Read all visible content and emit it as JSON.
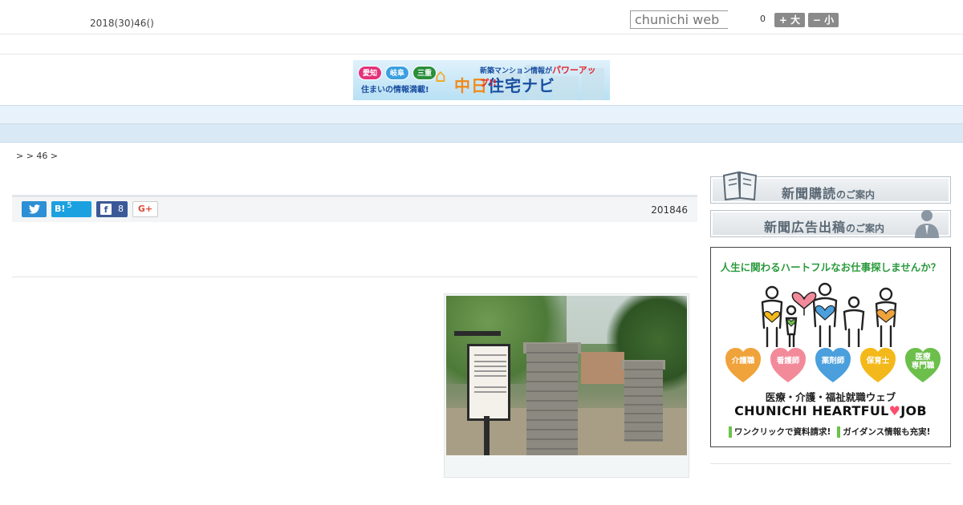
{
  "header": {
    "date": "2018(30)46()",
    "search_placeholder": "chunichi web",
    "font_size_value": "0",
    "font_larger_label": "+ 大",
    "font_smaller_label": "− 小"
  },
  "banner": {
    "pill_aichi": "愛知",
    "pill_gifu": "岐阜",
    "pill_mie": "三重",
    "tagline": "住まいの情報満載!",
    "headline": "新築マンション情報が",
    "headline_up": "パワーアップ!!",
    "brand_a": "中日",
    "brand_b": "住宅ナビ"
  },
  "nav": {
    "items": [
      "",
      "",
      "",
      "",
      "",
      "",
      "",
      "",
      ""
    ]
  },
  "breadcrumb": ">  > 46 >",
  "share": {
    "twitter_icon": "twitter-bird-icon",
    "hatena_label": "B!",
    "hatena_count": "5",
    "facebook_label": "f",
    "facebook_count": "8",
    "googleplus_label": "G+",
    "post_date": "201846"
  },
  "sidebar": {
    "subscribe_main": "新聞購読",
    "subscribe_small": "のご案内",
    "ad_main": "新聞広告出稿",
    "ad_small": "のご案内"
  },
  "ad": {
    "headline": "人生に関わるハートフルなお仕事探しませんか？",
    "hearts": [
      {
        "label": "介護職",
        "color": "#f0a33a"
      },
      {
        "label": "看護師",
        "color": "#f28a9a"
      },
      {
        "label": "薬剤師",
        "color": "#4a9fdc"
      },
      {
        "label": "保育士",
        "color": "#f3b81a"
      },
      {
        "label": "医療\n専門職",
        "color": "#6cbf4a"
      }
    ],
    "tagline": "医療・介護・福祉就職ウェブ",
    "brand_a": "CHUNICHI HEARTFUL",
    "brand_heart": "♥",
    "brand_b": "JOB",
    "footer_a": "ワンクリックで資料請求!",
    "footer_b": "ガイダンス情報も充実!"
  },
  "colors": {
    "nav_bg": "#e8f2fb",
    "subnav_bg": "#d9e9f6",
    "twitter": "#2d8fd5",
    "hatena": "#1ba1e0",
    "facebook": "#3b5998",
    "ad_green": "#2a9a3c"
  }
}
